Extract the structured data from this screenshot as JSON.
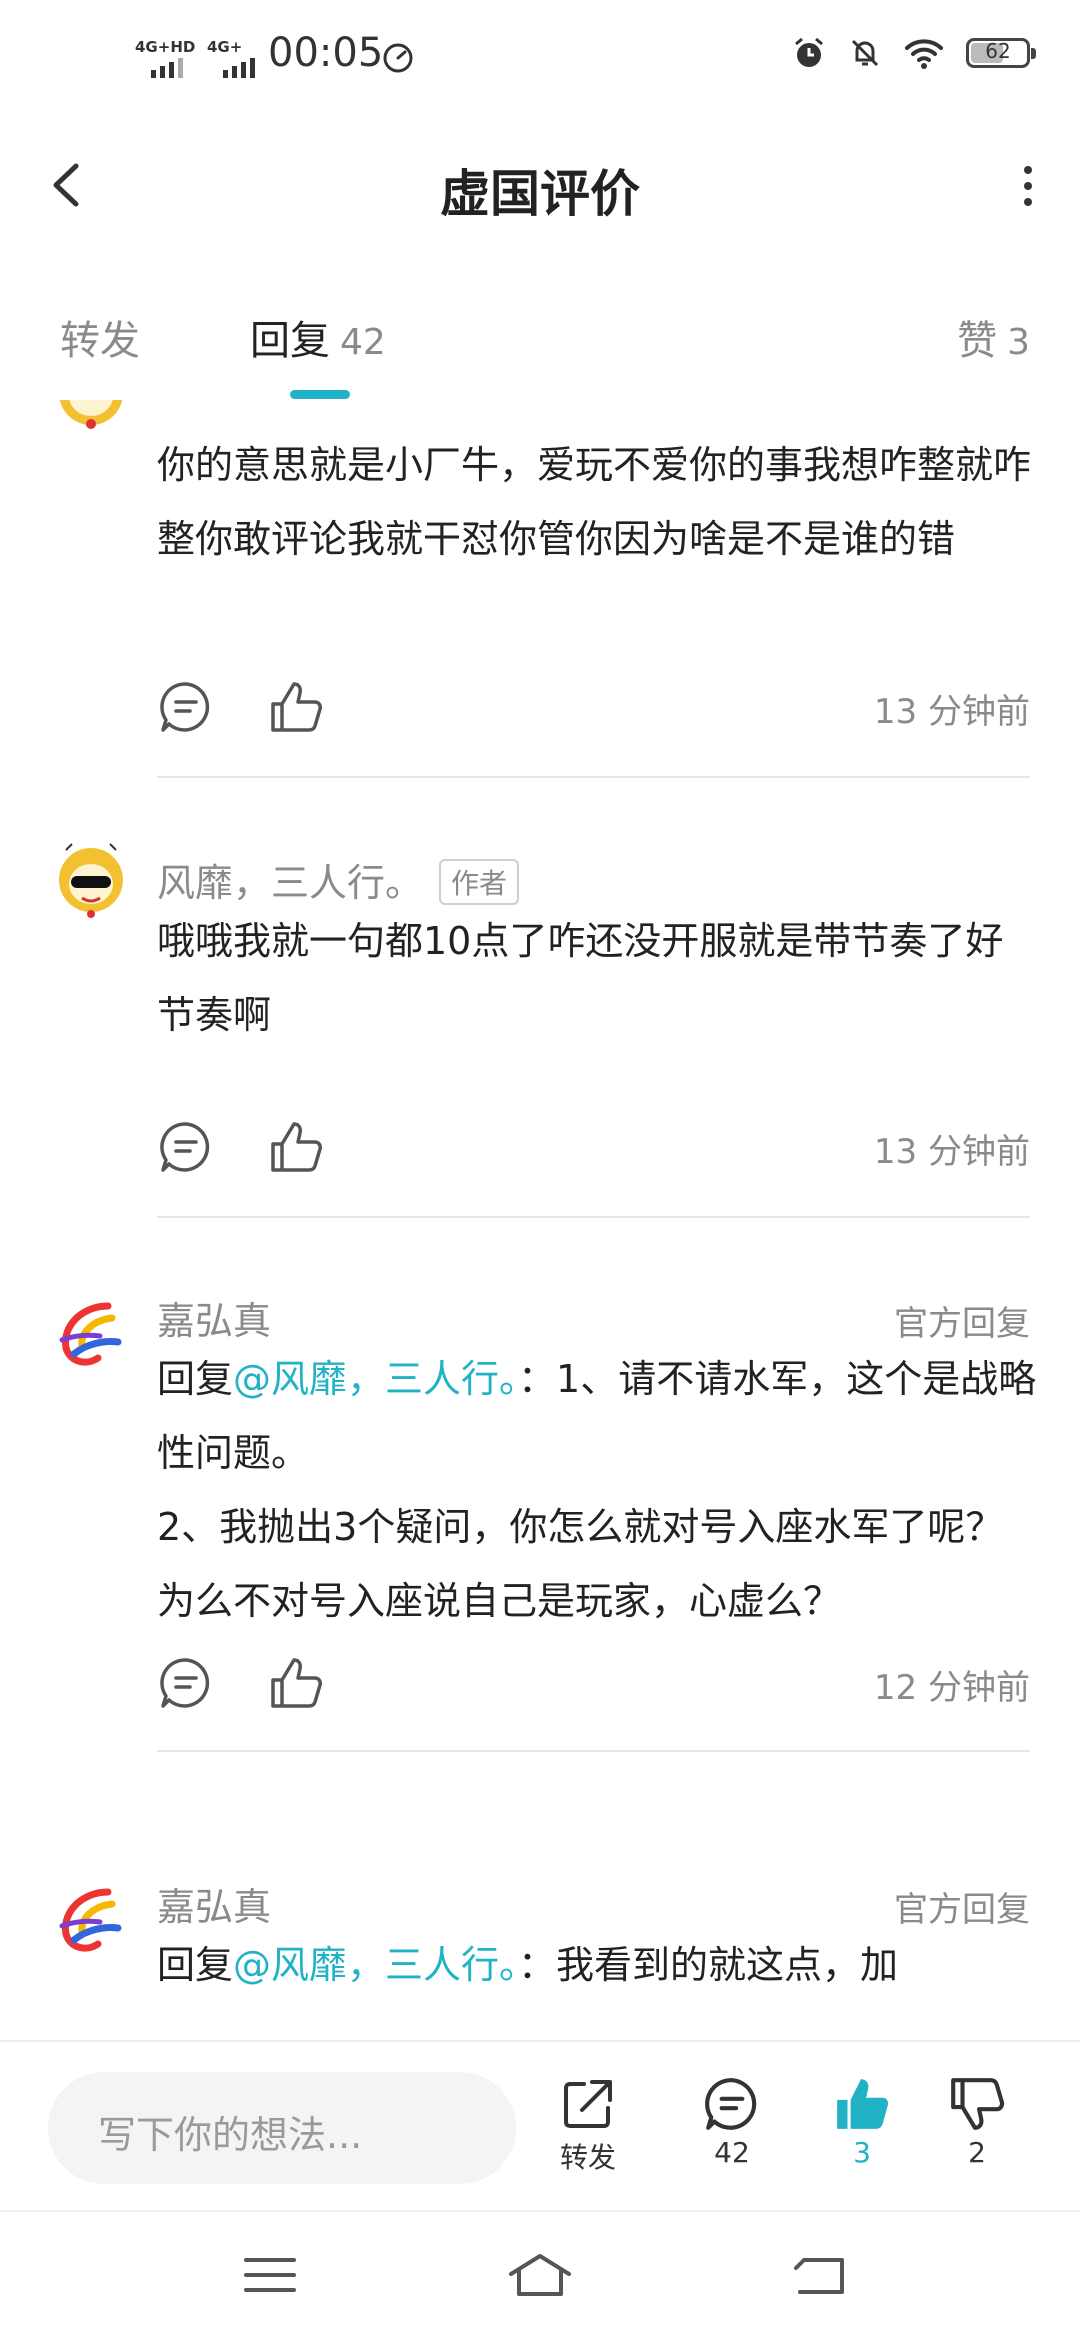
{
  "status_bar": {
    "network": [
      "4G+HD",
      "4G+"
    ],
    "time": "00:05",
    "battery": "62",
    "battery_level": 0.62
  },
  "header": {
    "title": "虚国评价"
  },
  "tabs": {
    "repost": "转发",
    "reply": "回复",
    "reply_count": "42",
    "like": "赞",
    "like_count": "3"
  },
  "comments": [
    {
      "text": "你的意思就是小厂牛，爱玩不爱你的事我想咋整就咋整你敢评论我就干怼你管你因为啥是不是谁的错",
      "time": "13 分钟前"
    },
    {
      "name": "风靡，三人行。",
      "tag": "作者",
      "text": "哦哦我就一句都10点了咋还没开服就是带节奏了好节奏啊",
      "time": "13 分钟前"
    },
    {
      "name": "嘉弘真",
      "official": "官方回复",
      "reply_prefix": "回复",
      "mention": "@风靡，三人行。",
      "text": "：1、请不请水军，这个是战略性问题。\n2、我抛出3个疑问，你怎么就对号入座水军了呢？为么不对号入座说自己是玩家，心虚么？",
      "time": "12 分钟前"
    },
    {
      "name": "嘉弘真",
      "official": "官方回复",
      "reply_prefix": "回复",
      "mention": "@风靡，三人行。",
      "text": "：我看到的就这点，加"
    }
  ],
  "bottom_bar": {
    "input_placeholder": "写下你的想法...",
    "repost_label": "转发",
    "comment_count": "42",
    "like_count": "3",
    "dislike_count": "2"
  },
  "colors": {
    "accent": "#22b2c6",
    "text_primary": "#222222",
    "text_secondary": "#8a8a8a"
  },
  "icons": [
    "back-arrow-icon",
    "more-vert-icon",
    "comment-icon",
    "thumb-up-icon",
    "share-icon",
    "thumb-down-icon",
    "menu-icon",
    "home-icon",
    "back-nav-icon"
  ]
}
